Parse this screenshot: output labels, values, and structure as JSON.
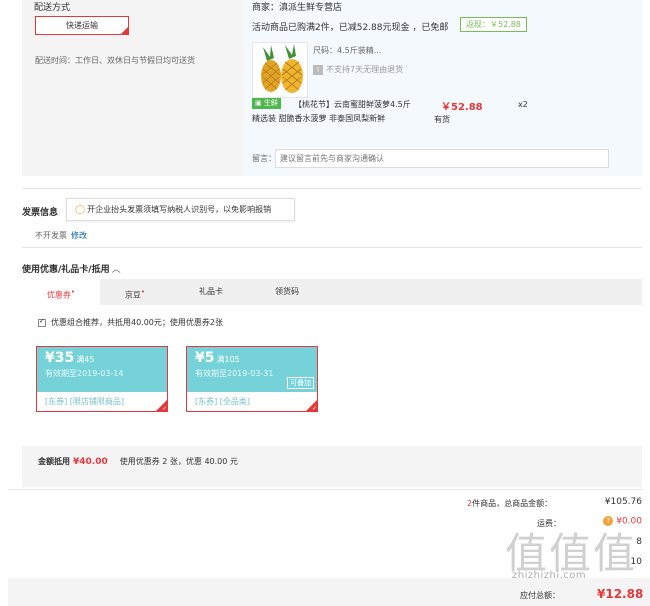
{
  "shipping": {
    "title": "配送方式",
    "method_button": "快递运输",
    "delivery_time": "配送时间：工作日、双休日与节假日均可送货"
  },
  "shop": {
    "name": "商家：滇派生鲜专营店",
    "promo_text": "活动商品已购满2件，已减52.88元现金 ，已免邮",
    "promo_badge": "返现：￥52.88",
    "product": {
      "spec": "尺码：4.5斤装精...",
      "no_return": "不支持7天无理由退货",
      "fresh_tag": "生鲜",
      "name": "【桃花节】云南蜜甜鲜菠萝4.5斤精选装 甜脆香水菠萝 非泰国凤梨新鲜",
      "price": "￥52.88",
      "stock": "有货",
      "qty": "x2"
    },
    "message_label": "留言：",
    "message_placeholder": "建议留言前先与商家沟通确认"
  },
  "invoice": {
    "title": "发票信息",
    "tip": "开企业抬头发票须填写纳税人识别号，以免影响报销",
    "value": "不开发票",
    "edit_link": "修改"
  },
  "coupons": {
    "title": "使用优惠/礼品卡/抵用",
    "chevron": "︿",
    "tabs": [
      {
        "label": "优惠券",
        "badge": "•"
      },
      {
        "label": "京豆",
        "badge": "•"
      },
      {
        "label": "礼品卡",
        "badge": ""
      },
      {
        "label": "领货码",
        "badge": ""
      }
    ],
    "combo_text": "优惠组合推荐，共抵用40.00元；使用优惠券2张",
    "items": [
      {
        "amount": "¥35",
        "condition": "满45",
        "expire": "有效期至2019-03-14",
        "scope": "[东券] [限店铺限商品]",
        "addable": ""
      },
      {
        "amount": "¥5",
        "condition": "满105",
        "expire": "有效期至2019-03-31",
        "scope": "[东券] [全品类]",
        "addable": "可叠加"
      }
    ],
    "deduct_label": "金额抵用",
    "deduct_value": "¥40.00",
    "used_text": "使用优惠券 2 张，优惠 40.00 元"
  },
  "summary": {
    "count_num": "2",
    "count_text": "件商品，总商品金额：",
    "goods_total": "¥105.76",
    "freight_label": "运费：",
    "freight_value": "¥0.00",
    "row3_value": "8",
    "row4_value": "10",
    "pay_label": "应付总额：",
    "pay_amount": "¥12.88"
  },
  "watermark": {
    "chars": "值值值",
    "url": "zhizhizhi.com"
  },
  "colors": {
    "accent_red": "#e4393c",
    "coupon_teal": "#75d2d8",
    "fresh_green": "#4fb84c",
    "link_blue": "#005ea7"
  }
}
